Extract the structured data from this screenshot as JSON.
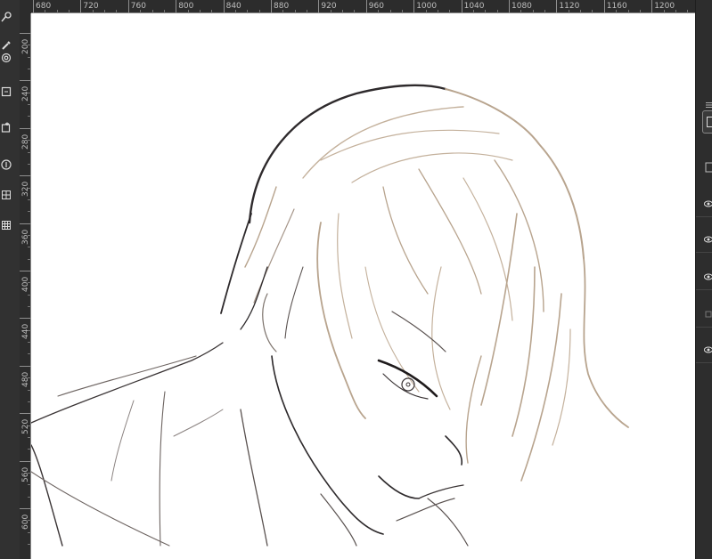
{
  "app": {
    "colors": {
      "toolbar_bg": "#313131",
      "ruler_bg": "#2c2c2c",
      "ruler_text": "#bdbdbd",
      "canvas_bg": "#ffffff",
      "line_dark": "#2e2a2c",
      "line_tan": "#b8a48e"
    }
  },
  "rulers": {
    "top_labels": [
      "680",
      "720",
      "760",
      "800",
      "840",
      "880",
      "920",
      "960",
      "1000",
      "1040",
      "1080",
      "1120",
      "1160",
      "1200"
    ],
    "left_labels": [
      "200",
      "240",
      "280",
      "320",
      "360",
      "400",
      "440",
      "480",
      "520",
      "560",
      "600"
    ]
  },
  "toolbar": {
    "tools": [
      {
        "icon": "brush-settings-icon"
      },
      {
        "icon": "eyedropper-icon"
      },
      {
        "icon": "target-icon"
      },
      {
        "icon": "frame-icon"
      },
      {
        "icon": "layer-add-icon"
      },
      {
        "icon": "circle-icon"
      },
      {
        "icon": "grid-icon"
      },
      {
        "icon": "tile-grid-icon"
      }
    ]
  },
  "layers_panel": {
    "rows": [
      {
        "visible": true
      },
      {
        "visible": true
      },
      {
        "visible": true
      },
      {
        "visible": false
      },
      {
        "visible": true
      }
    ]
  }
}
